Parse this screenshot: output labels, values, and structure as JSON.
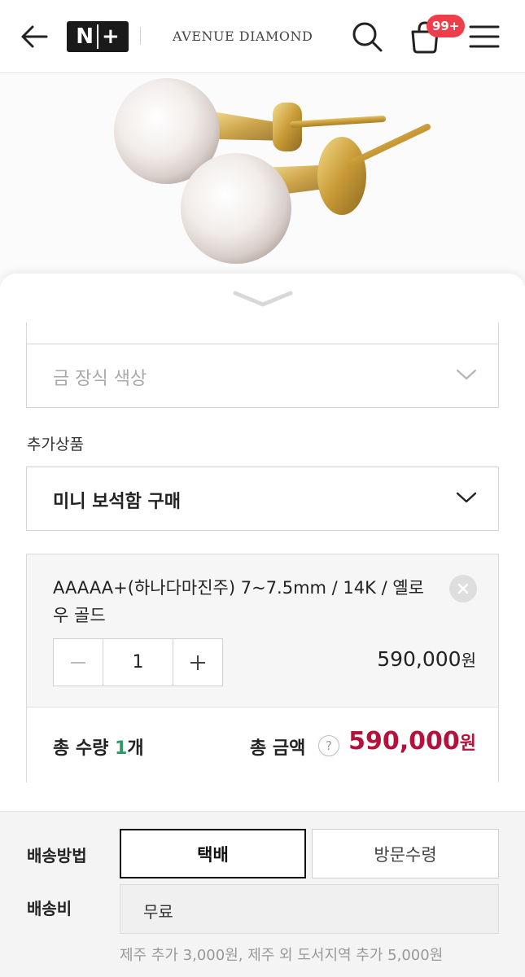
{
  "header": {
    "brand": "AVENUE DIAMOND",
    "naver_logo": "N+",
    "cart_badge": "99+",
    "icons": {
      "back": "back-arrow-icon",
      "search": "search-icon",
      "cart": "cart-bag-icon",
      "menu": "hamburger-menu-icon"
    }
  },
  "product": {
    "image_desc": "pearl-stud-earrings"
  },
  "options": {
    "gold_color_placeholder": "금 장식 색상",
    "addon_label": "추가상품",
    "addon_select": "미니 보석함 구매"
  },
  "selected_option": {
    "name": "AAAAA+(하나다마진주) 7~7.5mm / 14K / 옐로우 골드",
    "quantity": "1",
    "price": "590,000",
    "currency": "원"
  },
  "total": {
    "qty_label": "총 수량 ",
    "qty_value": "1",
    "qty_unit": "개",
    "amount_label": "총 금액",
    "help": "?",
    "amount": "590,000",
    "currency": "원"
  },
  "shipping": {
    "method_label": "배송방법",
    "methods": [
      "택배",
      "방문수령"
    ],
    "selected_method": "택배",
    "fee_label": "배송비",
    "fee_value": "무료",
    "note": "제주 추가 3,000원, 제주 외 도서지역 추가 5,000원"
  },
  "colors": {
    "accent_price": "#b5123b",
    "qty_highlight": "#2d9a63",
    "badge": "#ef3e4a"
  }
}
